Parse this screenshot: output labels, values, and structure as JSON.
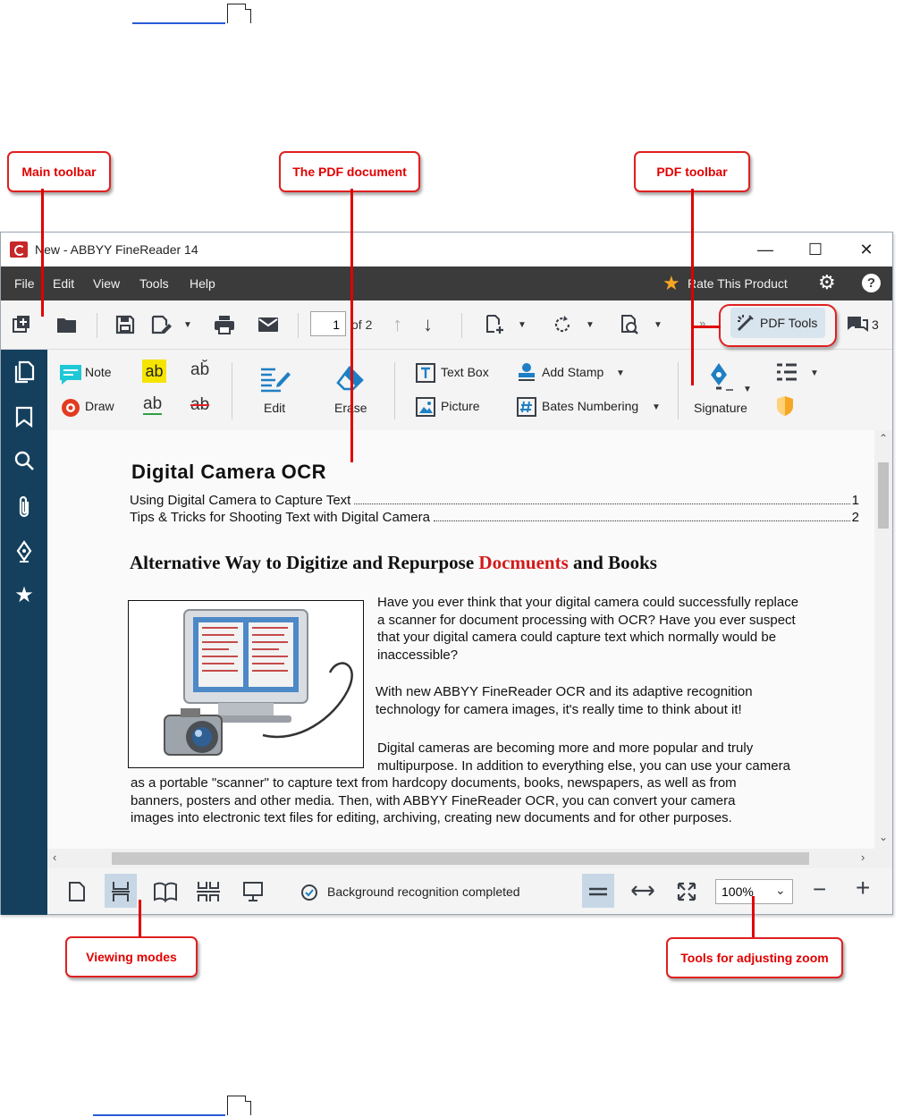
{
  "window": {
    "title": "New - ABBYY FineReader 14",
    "controls": {
      "minimize": "—",
      "maximize": "☐",
      "close": "✕"
    }
  },
  "menu": {
    "items": [
      "File",
      "Edit",
      "View",
      "Tools",
      "Help"
    ],
    "rate_label": "Rate This Product"
  },
  "main_toolbar": {
    "page_current": "1",
    "page_of": "of 2",
    "pdf_tools_label": "PDF Tools",
    "comments_count": "3"
  },
  "pdf_toolbar": {
    "note_label": "Note",
    "draw_label": "Draw",
    "highlight_label": "ab",
    "edit_label": "Edit",
    "erase_label": "Erase",
    "text_box_label": "Text Box",
    "picture_label": "Picture",
    "add_stamp_label": "Add Stamp",
    "bates_label": "Bates Numbering",
    "signature_label": "Signature"
  },
  "document": {
    "title": "Digital  Camera  OCR",
    "toc": [
      {
        "text": "Using  Digital Camera to Capture Text",
        "page": "1"
      },
      {
        "text": "Tips & Tricks for Shooting Text with Digital Camera",
        "page": "2"
      }
    ],
    "heading_before": "Alternative Way to Digitize and Repurpose ",
    "heading_red": "Docmuents",
    "heading_after": " and Books",
    "para1": [
      "Have you ever think that your digital camera could successfully replace",
      "a scanner for document processing with OCR? Have you ever suspect",
      "that your digital camera could capture text which  normally would be",
      "inaccessible?"
    ],
    "para2": [
      "With new ABBYY FineReader OCR and its adaptive recognition",
      "technology   for camera images, it's really time to think about it!"
    ],
    "para3": [
      "Digital cameras are becoming more and more popular and truly",
      "multipurpose.  In addition to everything else, you can use your camera"
    ],
    "para3_full": [
      "as a portable \"scanner\" to capture text from hardcopy documents, books, newspapers, as well as from",
      "banners, posters and other media. Then, with ABBYY FineReader OCR, you can convert your camera",
      "images into electronic text files for editing, archiving, creating new documents and for other purposes."
    ]
  },
  "status": {
    "recognition": "Background recognition completed",
    "zoom": "100%"
  },
  "callouts": {
    "main_toolbar": "Main toolbar",
    "pdf_document": "The PDF document",
    "pdf_toolbar": "PDF toolbar",
    "viewing_modes": "Viewing modes",
    "zoom_tools": "Tools for adjusting zoom"
  },
  "colors": {
    "sidebar": "#14405e",
    "menubar": "#3b3b3b",
    "callout_red": "#e00000",
    "accent_blue": "#1f7fc4"
  }
}
